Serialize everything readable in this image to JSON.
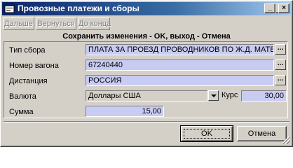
{
  "window": {
    "title": "Провозные платежи и сборы",
    "controls": {
      "minimize": "_",
      "maximize": "□",
      "close": "×"
    }
  },
  "toolbar": {
    "next_label": "Дальше",
    "back_label": "Вернуться",
    "end_label": "До конца"
  },
  "header": {
    "text": "Сохранить изменения - OK, выход - Отмена"
  },
  "form": {
    "fee_type": {
      "label": "Тип сбора",
      "value": "ПЛАТА ЗА ПРОЕЗД ПРОВОДНИКОВ ПО Ж.Д. МАТЕРИ"
    },
    "wagon_number": {
      "label": "Номер вагона",
      "value": "67240440"
    },
    "distance": {
      "label": "Дистанция",
      "value": "РОССИЯ"
    },
    "currency": {
      "label": "Валюта",
      "value": "Доллары США"
    },
    "rate": {
      "label": "Курс",
      "value": "30,00"
    },
    "amount": {
      "label": "Сумма",
      "value": "15,00"
    },
    "lookup_button": "..."
  },
  "buttons": {
    "ok_label": "OK",
    "cancel_label": "Отмена"
  },
  "colors": {
    "field_bg": "#c8cbf2",
    "face": "#d4d0c8",
    "title_start": "#0a246a",
    "title_end": "#a6caf0"
  }
}
